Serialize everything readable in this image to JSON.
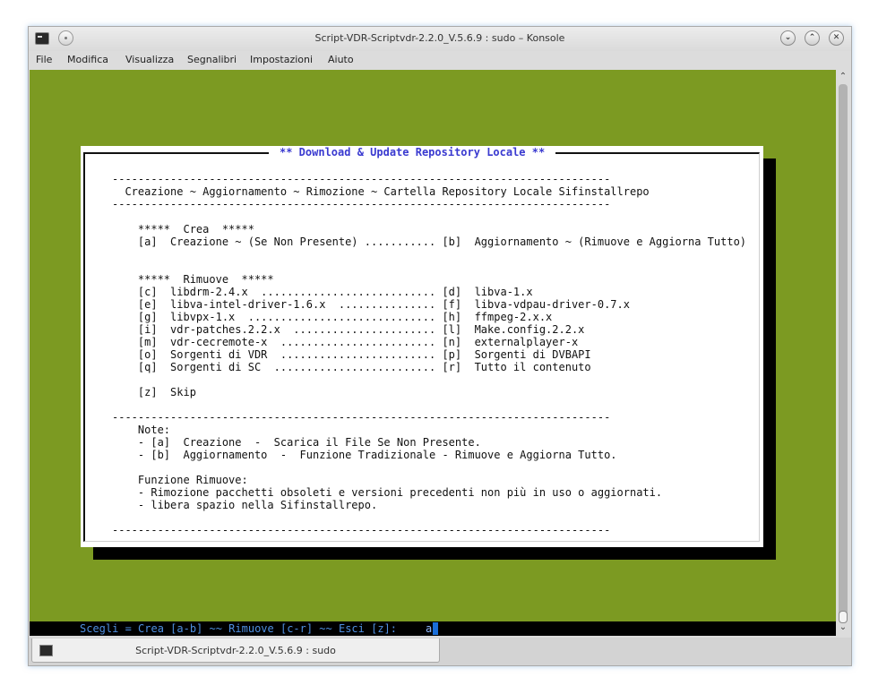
{
  "window": {
    "title": "Script-VDR-Scriptvdr-2.2.0_V.5.6.9 : sudo – Konsole",
    "buttons": {
      "minimize": "⌄",
      "maximize": "⌃",
      "close": "✕"
    }
  },
  "menubar": {
    "items": [
      "File",
      "Modifica",
      "Visualizza",
      "Segnalibri",
      "Impostazioni",
      "Aiuto"
    ]
  },
  "scrollbar": {
    "up": "⌃",
    "down": "⌄"
  },
  "dialog": {
    "title": "** Download & Update Repository Locale **",
    "body": "-----------------------------------------------------------------------------\n  Creazione ~ Aggiornamento ~ Rimozione ~ Cartella Repository Locale Sifinstallrepo\n-----------------------------------------------------------------------------\n\n    *****  Crea  *****\n    [a]  Creazione ~ (Se Non Presente) ........... [b]  Aggiornamento ~ (Rimuove e Aggiorna Tutto)\n\n\n    *****  Rimuove  *****\n    [c]  libdrm-2.4.x  ........................... [d]  libva-1.x\n    [e]  libva-intel-driver-1.6.x  ............... [f]  libva-vdpau-driver-0.7.x\n    [g]  libvpx-1.x  ............................. [h]  ffmpeg-2.x.x\n    [i]  vdr-patches.2.2.x  ...................... [l]  Make.config.2.2.x\n    [m]  vdr-cecremote-x  ........................ [n]  externalplayer-x\n    [o]  Sorgenti di VDR  ........................ [p]  Sorgenti di DVBAPI\n    [q]  Sorgenti di SC  ......................... [r]  Tutto il contenuto\n\n    [z]  Skip\n\n-----------------------------------------------------------------------------\n    Note:\n    - [a]  Creazione  -  Scarica il File Se Non Presente.\n    - [b]  Aggiornamento  -  Funzione Tradizionale - Rimuove e Aggiorna Tutto.\n\n    Funzione Rimuove:\n    - Rimozione pacchetti obsoleti e versioni precedenti non più in uso o aggiornati.\n    - libera spazio nella Sifinstallrepo.\n\n-----------------------------------------------------------------------------"
  },
  "prompt": {
    "text": "Scegli = Crea [a-b] ~~ Rimuove [c-r] ~~ Esci [z]:",
    "input_value": "a"
  },
  "tab": {
    "label": "Script-VDR-Scriptvdr-2.2.0_V.5.6.9 : sudo"
  },
  "colors": {
    "terminal_bg": "#7c9a22",
    "dialog_title": "#3a3ad0",
    "prompt_text": "#4f8fe0",
    "cursor": "#1a6ed8"
  }
}
